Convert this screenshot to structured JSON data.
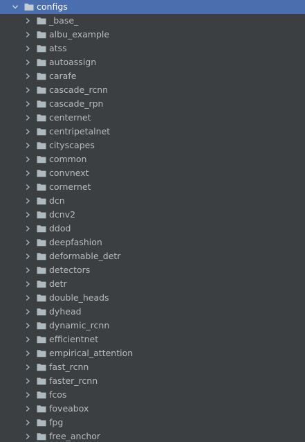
{
  "tree": {
    "root": {
      "label": "configs",
      "expanded": true,
      "icon": "folder-icon",
      "chevron_icon": "chevron-down-icon"
    },
    "children": [
      "_base_",
      "albu_example",
      "atss",
      "autoassign",
      "carafe",
      "cascade_rcnn",
      "cascade_rpn",
      "centernet",
      "centripetalnet",
      "cityscapes",
      "common",
      "convnext",
      "cornernet",
      "dcn",
      "dcnv2",
      "ddod",
      "deepfashion",
      "deformable_detr",
      "detectors",
      "detr",
      "double_heads",
      "dyhead",
      "dynamic_rcnn",
      "efficientnet",
      "empirical_attention",
      "fast_rcnn",
      "faster_rcnn",
      "fcos",
      "foveabox",
      "fpg",
      "free_anchor"
    ],
    "child_icon": "folder-icon",
    "child_chevron_icon": "chevron-right-icon"
  },
  "colors": {
    "background": "#3c3f41",
    "selection": "#4b6eaf",
    "text": "#bbbbbb",
    "selected_text": "#ffffff",
    "folder": "#aeb9c0",
    "chevron": "#a9b7c6"
  }
}
